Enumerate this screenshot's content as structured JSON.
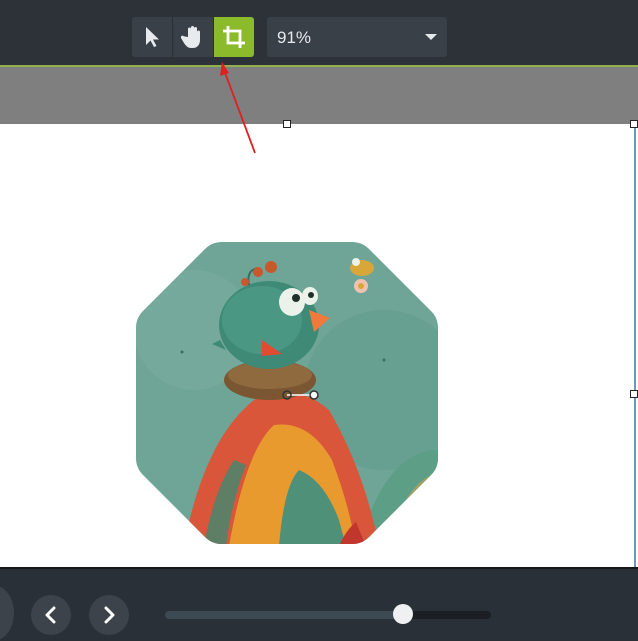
{
  "toolbar": {
    "tools": [
      {
        "icon": "pointer-icon",
        "active": false
      },
      {
        "icon": "hand-icon",
        "active": false
      },
      {
        "icon": "crop-icon",
        "active": true
      }
    ],
    "zoom": {
      "value": "91%"
    },
    "accent_color": "#8bbb2b"
  },
  "canvas": {
    "image": "octagon-cropped-bird-illustration",
    "annotation": "red-arrow-pointing-to-crop-tool"
  },
  "bottom_bar": {
    "prev_icon": "chevron-left-icon",
    "next_icon": "chevron-right-icon",
    "slider_value": 0.73
  }
}
